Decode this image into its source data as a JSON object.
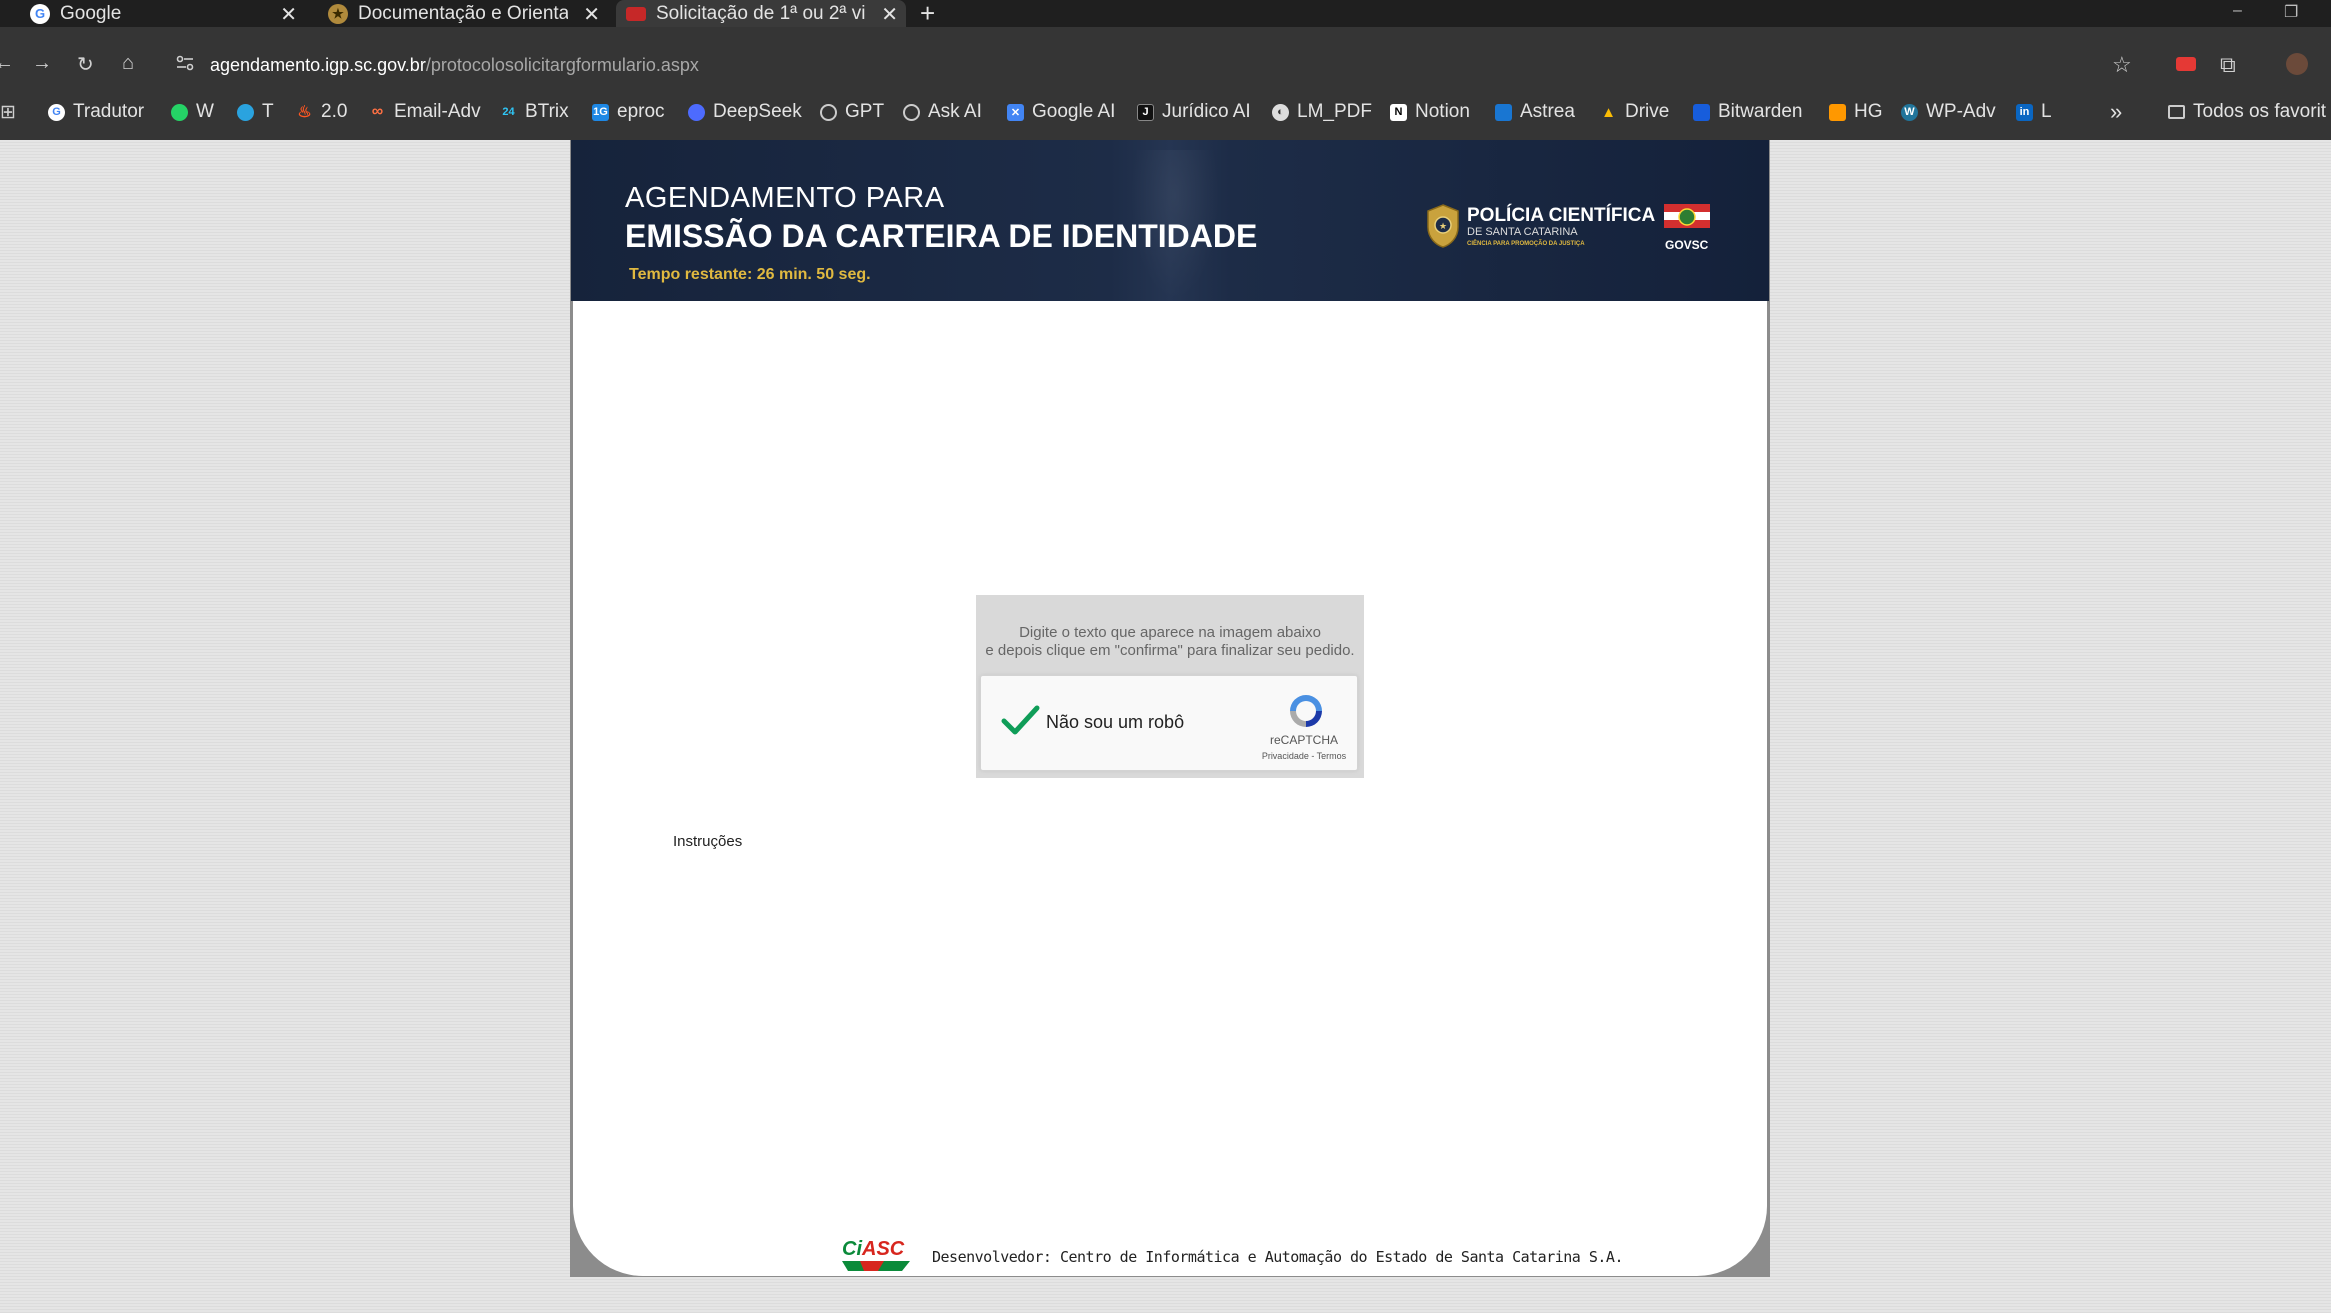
{
  "browser": {
    "tabs": [
      {
        "title": "Google"
      },
      {
        "title": "Documentação e Orienta"
      },
      {
        "title": "Solicitação de 1ª ou 2ª vi"
      }
    ],
    "new_tab": "+",
    "close_glyph": "✕",
    "url_host": "agendamento.igp.sc.gov.br",
    "url_path": "/protocolosolicitargformulario.aspx",
    "bookmarks": [
      {
        "label": "Tradutor",
        "icon": "google-icon",
        "color": "#ffffff"
      },
      {
        "label": "W",
        "icon": "whatsapp-icon",
        "color": "#25d366"
      },
      {
        "label": "T",
        "icon": "telegram-icon",
        "color": "#2aa3df"
      },
      {
        "label": "2.0",
        "icon": "flame-icon",
        "color": "#ff5722"
      },
      {
        "label": "Email-Adv",
        "icon": "link-icon",
        "color": "#ff7043"
      },
      {
        "label": "BTrix",
        "icon": "bitrix-icon",
        "color": "#2fc6f6"
      },
      {
        "label": "eproc",
        "icon": "eproc-icon",
        "color": "#1e88e5"
      },
      {
        "label": "DeepSeek",
        "icon": "deepseek-icon",
        "color": "#4d6bfe"
      },
      {
        "label": "GPT",
        "icon": "openai-icon",
        "color": "#cccccc"
      },
      {
        "label": "Ask AI",
        "icon": "openai-icon",
        "color": "#cccccc"
      },
      {
        "label": "Google AI",
        "icon": "google-ai-icon",
        "color": "#4285f4"
      },
      {
        "label": "Jurídico AI",
        "icon": "juridico-icon",
        "color": "#111111"
      },
      {
        "label": "LM_PDF",
        "icon": "lm-icon",
        "color": "#dddddd"
      },
      {
        "label": "Notion",
        "icon": "notion-icon",
        "color": "#ffffff"
      },
      {
        "label": "Astrea",
        "icon": "astrea-icon",
        "color": "#1976d2"
      },
      {
        "label": "Drive",
        "icon": "drive-icon",
        "color": "#fbbc04"
      },
      {
        "label": "Bitwarden",
        "icon": "bitwarden-icon",
        "color": "#175ddc"
      },
      {
        "label": "HG",
        "icon": "hg-icon",
        "color": "#ff9800"
      },
      {
        "label": "WP-Adv",
        "icon": "wordpress-icon",
        "color": "#21759b"
      },
      {
        "label": "L",
        "icon": "linkedin-icon",
        "color": "#0a66c2"
      }
    ],
    "more_bookmarks": "»",
    "all_bookmarks": "Todos os favorit"
  },
  "header": {
    "line1": "AGENDAMENTO PARA",
    "line2": "EMISSÃO DA CARTEIRA DE IDENTIDADE",
    "timer": "Tempo restante: 26 min. 50 seg.",
    "org_title": "POLÍCIA CIENTÍFICA",
    "org_subtitle": "DE SANTA CATARINA",
    "org_tagline": "CIÊNCIA PARA PROMOÇÃO DA JUSTIÇA",
    "gov_label": "GOVSC"
  },
  "captcha": {
    "instruction_line1": "Digite o texto que aparece na imagem abaixo",
    "instruction_line2": "e depois clique em \"confirma\" para finalizar seu pedido.",
    "checkbox_label": "Não sou um robô",
    "checked": true,
    "brand": "reCAPTCHA",
    "links": "Privacidade - Termos"
  },
  "instructions_link": "Instruções",
  "footer": {
    "logo_text": "CiASC",
    "developer": "Desenvolvedor: Centro de Informática e Automação do Estado de Santa Catarina S.A."
  },
  "colors": {
    "header_bg": "#1d2c47",
    "timer": "#e0b940",
    "check": "#0f9d58",
    "ciasc_green": "#0b8a3a",
    "ciasc_red": "#d7261e"
  }
}
